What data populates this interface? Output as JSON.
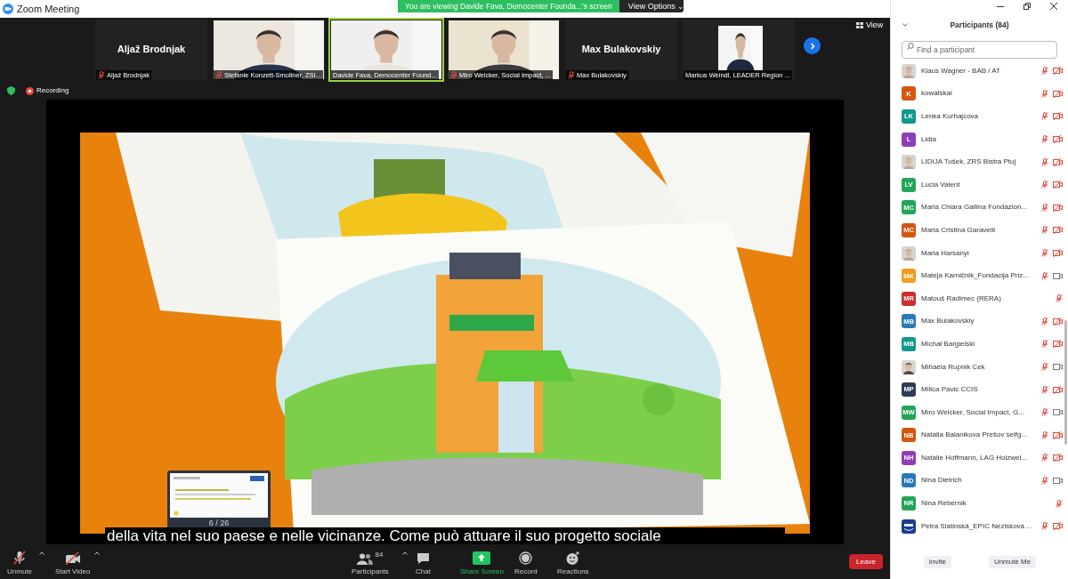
{
  "window": {
    "title": "Zoom Meeting"
  },
  "banner": {
    "text": "You are viewing Davide Fava, Democenter Founda...'s screen",
    "options": "View Options ⌄"
  },
  "thumbnails": [
    {
      "kind": "name",
      "big_name": "Aljaž Brodnjak",
      "label": "Aljaž Brodnjak",
      "muted": true,
      "speaking": false
    },
    {
      "kind": "video",
      "label": "Stefanie Konzett-Smoliner, ZSI...",
      "muted": true,
      "speaking": false
    },
    {
      "kind": "video",
      "label": "Davide Fava, Democenter Found...",
      "muted": false,
      "speaking": true
    },
    {
      "kind": "video",
      "label": "Miro Welcker, Social Impact, ...",
      "muted": true,
      "speaking": false
    },
    {
      "kind": "name",
      "big_name": "Max Bulakovskiy",
      "label": "Max Bulakovskiy",
      "muted": true,
      "speaking": false
    },
    {
      "kind": "avatar",
      "label": "Markus Weindl, LEADER Region ...",
      "muted": false,
      "speaking": false
    }
  ],
  "view_button": "View",
  "recording": "Recording",
  "subtitle": "della vita nel suo paese e nelle vicinanze. Come può attuare il suo progetto sociale",
  "slide_counter": "6 / 26",
  "toolbar": [
    {
      "kind": "mic",
      "label": "Unmute",
      "caret": true
    },
    {
      "kind": "video",
      "label": "Start Video",
      "caret": true
    },
    {
      "kind": "participants",
      "label": "Participants",
      "count": "84",
      "caret": true
    },
    {
      "kind": "chat",
      "label": "Chat",
      "caret": false
    },
    {
      "kind": "share",
      "label": "Share Screen",
      "caret": false
    },
    {
      "kind": "record",
      "label": "Record",
      "caret": false
    },
    {
      "kind": "reactions",
      "label": "Reactions",
      "caret": false
    }
  ],
  "leave_button": "Leave",
  "participants_panel": {
    "title": "Participants (84)",
    "search": {
      "placeholder": "Find a participant"
    },
    "participants": [
      {
        "name": "Klaus Wagner - BAB / AT",
        "muted": true,
        "video_on": false
      },
      {
        "name": "kowalskai",
        "kind": "initials",
        "initials": "K",
        "color": "#d4560f",
        "muted": true,
        "video_on": false
      },
      {
        "name": "Lenka Kurhajcova",
        "kind": "initials",
        "initials": "LK",
        "color": "#11998b",
        "muted": true,
        "video_on": false
      },
      {
        "name": "Lidia",
        "kind": "initials",
        "initials": "L",
        "color": "#8e3fb8",
        "muted": true,
        "video_on": false
      },
      {
        "name": "LIDIJA Tušek, ZRS Bistra Ptuj",
        "muted": true,
        "video_on": false
      },
      {
        "name": "Lucia Valent",
        "kind": "initials",
        "initials": "LV",
        "color": "#23a55a",
        "muted": true,
        "video_on": false
      },
      {
        "name": "Maria Chiara Gallina Fondazion...",
        "kind": "initials",
        "initials": "MC",
        "color": "#23a55a",
        "muted": true,
        "video_on": false
      },
      {
        "name": "Maria Cristina Garavelli",
        "kind": "initials",
        "initials": "MC",
        "color": "#d4560f",
        "muted": true,
        "video_on": false
      },
      {
        "name": "Maria Harsanyi",
        "muted": true,
        "video_on": false
      },
      {
        "name": "Mateja Karničnik_Fundacija Priz...",
        "kind": "initials",
        "initials": "MK",
        "color": "#f39c1f",
        "muted": true,
        "video_on": true
      },
      {
        "name": "Matouš Radimec (RERA)",
        "kind": "initials",
        "initials": "MR",
        "color": "#c9302c",
        "muted": true
      },
      {
        "name": "Max Bulakovskiy",
        "kind": "initials",
        "initials": "MB",
        "color": "#2a7ab8",
        "muted": true,
        "video_on": false
      },
      {
        "name": "Michał Bargielski",
        "kind": "initials",
        "initials": "MB",
        "color": "#11998b",
        "muted": true,
        "video_on": false
      },
      {
        "name": "Mihaela Rupnik Cek",
        "muted": true,
        "video_on": true
      },
      {
        "name": "Milica Pavic CCIS",
        "kind": "initials",
        "initials": "MP",
        "color": "#2c3e55",
        "muted": true,
        "video_on": false
      },
      {
        "name": "Miro Welcker, Social Impact, G...",
        "kind": "initials",
        "initials": "MW",
        "color": "#23a55a",
        "muted": true,
        "video_on": true
      },
      {
        "name": "Natalia Balanikova Prešov selfg...",
        "kind": "initials",
        "initials": "NB",
        "color": "#d4560f",
        "muted": true,
        "video_on": false
      },
      {
        "name": "Natalie Hoffmann, LAG Holzwel...",
        "kind": "initials",
        "initials": "NH",
        "color": "#8e3fb8",
        "muted": true,
        "video_on": false
      },
      {
        "name": "Nina Dietrich",
        "kind": "initials",
        "initials": "ND",
        "color": "#2a7ab8",
        "muted": true,
        "video_on": true
      },
      {
        "name": "Nina Rebernik",
        "kind": "initials",
        "initials": "NR",
        "color": "#23a55a",
        "muted": true
      },
      {
        "name": "Petra Slatinská_EPIC Nezisková ...",
        "kind": "logo",
        "muted": true,
        "video_on": false
      }
    ],
    "buttons": [
      "Invite",
      "Unmute Me"
    ]
  }
}
